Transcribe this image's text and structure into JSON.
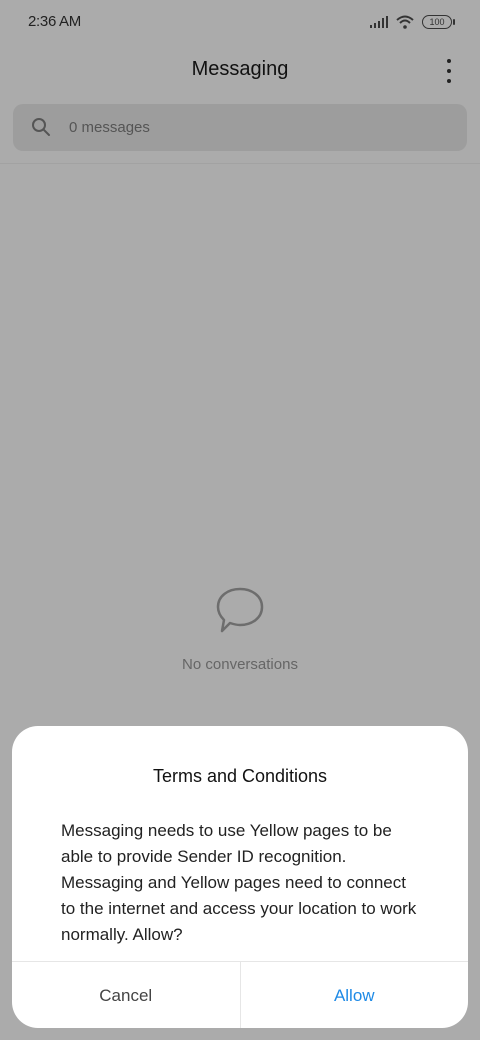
{
  "status_bar": {
    "time": "2:36 AM",
    "battery": "100",
    "icons": [
      "signal-icon",
      "wifi-icon",
      "battery-icon"
    ]
  },
  "header": {
    "title": "Messaging",
    "menu_icon": "more-vertical-icon"
  },
  "search": {
    "icon": "search-icon",
    "placeholder": "0 messages"
  },
  "empty_state": {
    "icon": "speech-bubble-icon",
    "text": "No conversations"
  },
  "dialog": {
    "title": "Terms and Conditions",
    "message": "Messaging needs to use Yellow pages to be able to provide Sender ID recognition. Messaging and Yellow pages need to connect to the internet and access your location to work normally. Allow?",
    "cancel_label": "Cancel",
    "allow_label": "Allow"
  },
  "colors": {
    "scrim": "#ababab",
    "accent": "#1e8ae6",
    "dialog_bg": "#ffffff"
  }
}
